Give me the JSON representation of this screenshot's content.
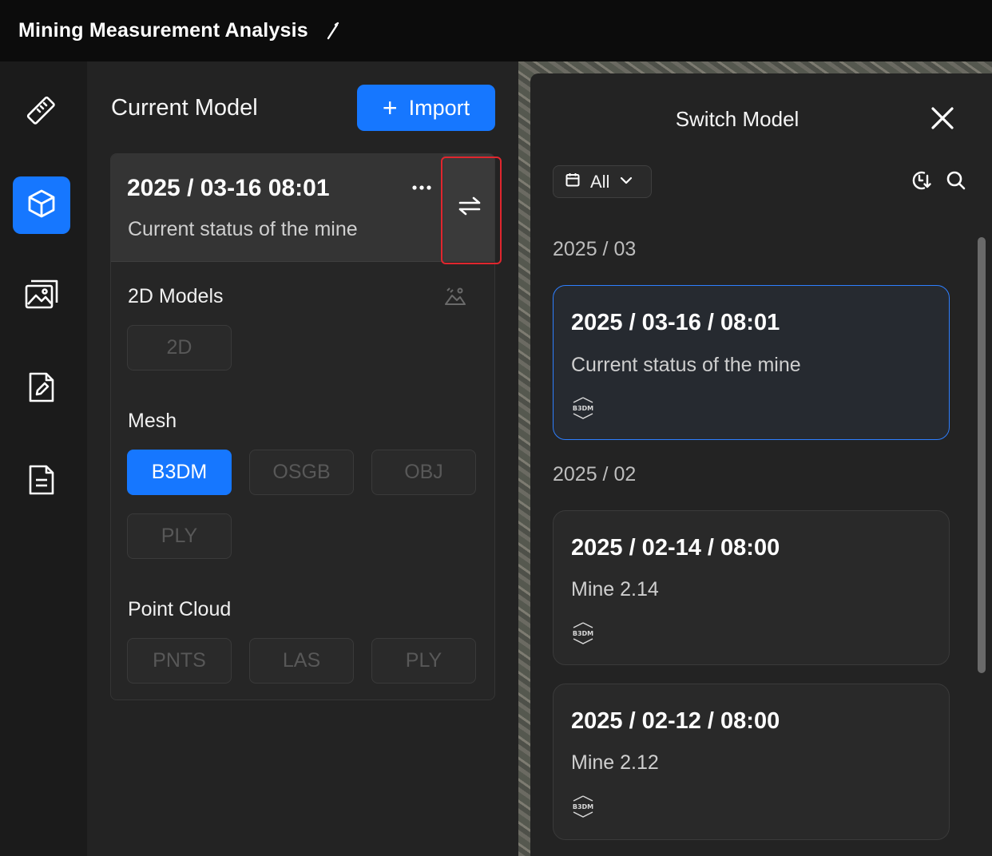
{
  "app": {
    "title": "Mining Measurement Analysis"
  },
  "rail": {
    "items": [
      {
        "icon": "ruler-icon",
        "active": false
      },
      {
        "icon": "cube-icon",
        "active": true
      },
      {
        "icon": "gallery-icon",
        "active": false
      },
      {
        "icon": "document-edit-icon",
        "active": false
      },
      {
        "icon": "report-icon",
        "active": false
      }
    ]
  },
  "panel": {
    "title": "Current Model",
    "import_label": "Import",
    "current": {
      "date": "2025 / 03-16 08:01",
      "description": "Current status of the mine"
    },
    "sections": {
      "models_2d": {
        "label": "2D Models",
        "formats": [
          "2D"
        ]
      },
      "mesh": {
        "label": "Mesh",
        "formats": [
          "B3DM",
          "OSGB",
          "OBJ",
          "PLY"
        ],
        "active": "B3DM"
      },
      "point_cloud": {
        "label": "Point Cloud",
        "formats": [
          "PNTS",
          "LAS",
          "PLY"
        ]
      }
    }
  },
  "drawer": {
    "title": "Switch Model",
    "filter_label": "All",
    "groups": [
      {
        "label": "2025 / 03",
        "items": [
          {
            "date": "2025 / 03-16 / 08:01",
            "description": "Current status of the mine",
            "format_badge": "B3DM",
            "selected": true
          }
        ]
      },
      {
        "label": "2025 / 02",
        "items": [
          {
            "date": "2025 / 02-14 / 08:00",
            "description": "Mine 2.14",
            "format_badge": "B3DM",
            "selected": false
          },
          {
            "date": "2025 / 02-12 / 08:00",
            "description": "Mine 2.12",
            "format_badge": "B3DM",
            "selected": false
          }
        ]
      }
    ]
  },
  "colors": {
    "accent": "#1677ff",
    "highlight": "#e0262e"
  }
}
